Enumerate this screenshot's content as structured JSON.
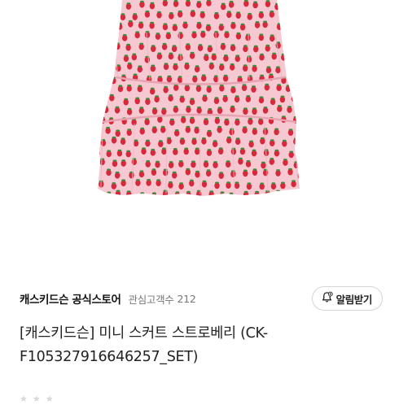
{
  "product": {
    "image_alt": "pink strawberry print tiered mini skirt",
    "title_line1": "[캐스키드슨] 미니 스커트 스트로베리 (CK-",
    "title_line2": "F105327916646257_SET)"
  },
  "store": {
    "name": "캐스키드슨 공식스토어",
    "follower_label": "관심고객수",
    "follower_count": "212",
    "notify_button_label": "알림받기",
    "notify_icon": "bell-plus-icon"
  },
  "colors": {
    "skirt_base": "#f6c9d2",
    "strawberry_red": "#d8283c",
    "leaf_green": "#3f8a3a"
  }
}
